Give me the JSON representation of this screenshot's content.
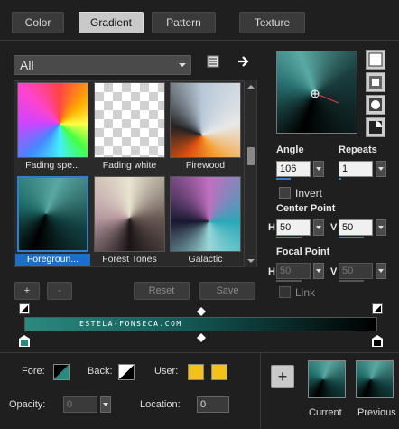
{
  "tabs": [
    "Color",
    "Gradient",
    "Pattern",
    "Texture"
  ],
  "category": "All",
  "gallery": [
    {
      "caption": "Fading spe..."
    },
    {
      "caption": "Fading white"
    },
    {
      "caption": "Firewood"
    },
    {
      "caption": "Foregroun..."
    },
    {
      "caption": "Forest Tones"
    },
    {
      "caption": "Galactic"
    }
  ],
  "buttons": {
    "add": "+",
    "remove": "-",
    "reset": "Reset",
    "save": "Save"
  },
  "angle": {
    "label": "Angle",
    "value": "106"
  },
  "repeats": {
    "label": "Repeats",
    "value": "1"
  },
  "invert": {
    "label": "Invert",
    "checked": false
  },
  "center_point": {
    "label": "Center Point",
    "h_label": "H",
    "h": "50",
    "v_label": "V",
    "v": "50"
  },
  "focal_point": {
    "label": "Focal Point",
    "h_label": "H",
    "h": "50",
    "v_label": "V",
    "v": "50"
  },
  "link": {
    "label": "Link"
  },
  "strip_watermark": "ESTELA-FONSECA.COM",
  "fore_label": "Fore:",
  "back_label": "Back:",
  "user_label": "User:",
  "opacity": {
    "label": "Opacity:",
    "value": "0"
  },
  "location": {
    "label": "Location:",
    "value": "0"
  },
  "add_button": "+",
  "current_label": "Current",
  "previous_label": "Previous",
  "colors": {
    "user": "#f2c11c",
    "selection": "#1c6ec7",
    "accent": "#2d7fd3"
  }
}
